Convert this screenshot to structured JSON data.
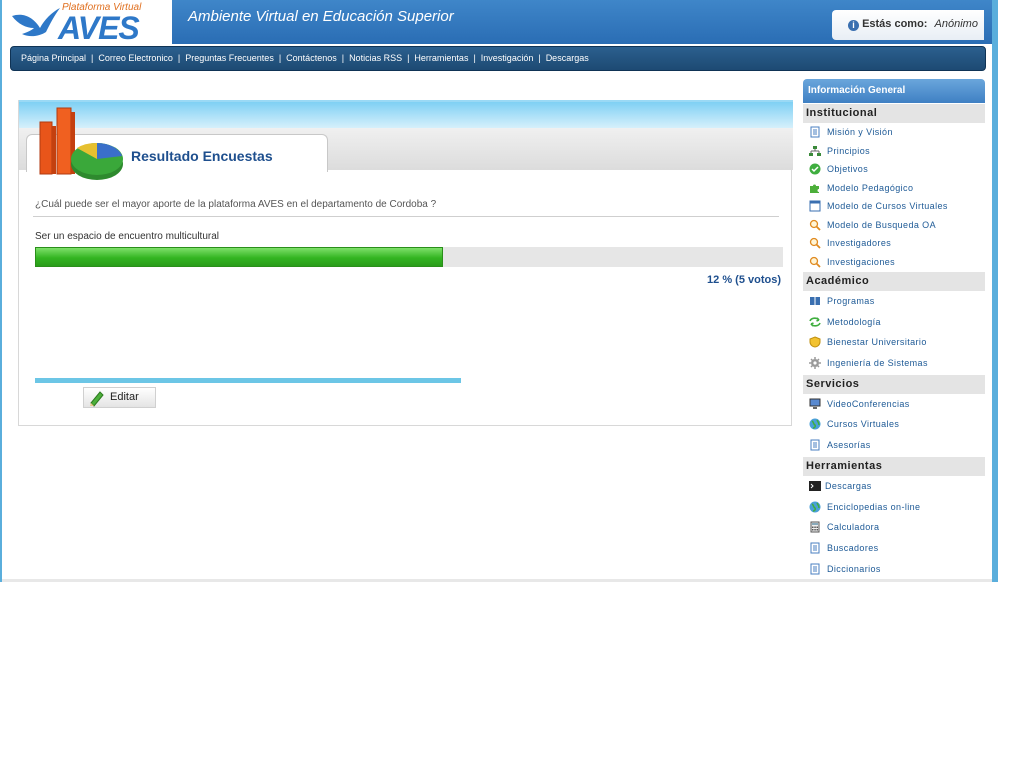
{
  "header": {
    "logo_top": "Plataforma Virtual",
    "logo_main": "AVES",
    "site_title": "Ambiente Virtual en Educación Superior",
    "user_label": "Estás como:",
    "user_value": "Anónimo"
  },
  "nav": {
    "items": [
      "Página Principal",
      "Correo Electronico",
      "Preguntas Frecuentes",
      "Contáctenos",
      "Noticias RSS",
      "Herramientas",
      "Investigación",
      "Descargas"
    ]
  },
  "poll": {
    "title": "Resultado Encuestas",
    "question": "¿Cuál puede ser el mayor aporte de la plataforma AVES en el departamento de Cordoba ?",
    "answer": "Ser un espacio de encuentro multicultural",
    "bar_fraction": 0.545,
    "result": "12 % (5 votos)",
    "edit_label": "Editar"
  },
  "sidebar": {
    "header": "Información General",
    "sections": [
      {
        "title": "Institucional",
        "items": [
          {
            "label": "Misión y Visión",
            "icon": "document-icon"
          },
          {
            "label": "Principios",
            "icon": "sitemap-icon"
          },
          {
            "label": "Objetivos",
            "icon": "check-icon"
          },
          {
            "label": "Modelo Pedagógico",
            "icon": "puzzle-icon"
          },
          {
            "label": "Modelo de Cursos Virtuales",
            "icon": "window-icon"
          },
          {
            "label": "Modelo de Busqueda OA",
            "icon": "magnifier-icon"
          },
          {
            "label": "Investigadores",
            "icon": "magnifier-icon"
          },
          {
            "label": "Investigaciones",
            "icon": "magnifier-icon"
          }
        ]
      },
      {
        "title": "Académico",
        "items": [
          {
            "label": "Programas",
            "icon": "book-icon"
          },
          {
            "label": "Metodología",
            "icon": "arrows-icon"
          },
          {
            "label": "Bienestar Universitario",
            "icon": "shield-icon"
          },
          {
            "label": "Ingeniería de Sistemas",
            "icon": "gear-icon"
          }
        ]
      },
      {
        "title": "Servicios",
        "items": [
          {
            "label": "VideoConferencias",
            "icon": "monitor-icon"
          },
          {
            "label": "Cursos Virtuales",
            "icon": "globe-icon"
          },
          {
            "label": "Asesorías",
            "icon": "document-icon"
          }
        ]
      },
      {
        "title": "Herramientas",
        "items": [
          {
            "label": "Descargas",
            "icon": "terminal-icon"
          },
          {
            "label": "Enciclopedias on-line",
            "icon": "globe-icon"
          },
          {
            "label": "Calculadora",
            "icon": "calculator-icon"
          },
          {
            "label": "Buscadores",
            "icon": "document-icon"
          },
          {
            "label": "Diccionarios",
            "icon": "document-icon"
          }
        ]
      }
    ]
  },
  "colors": {
    "header_blue": "#2e78c8",
    "nav_dark": "#1d4a73",
    "title_blue": "#1e4f8e",
    "bar_green": "#33b521",
    "link_blue": "#1e5a96"
  }
}
